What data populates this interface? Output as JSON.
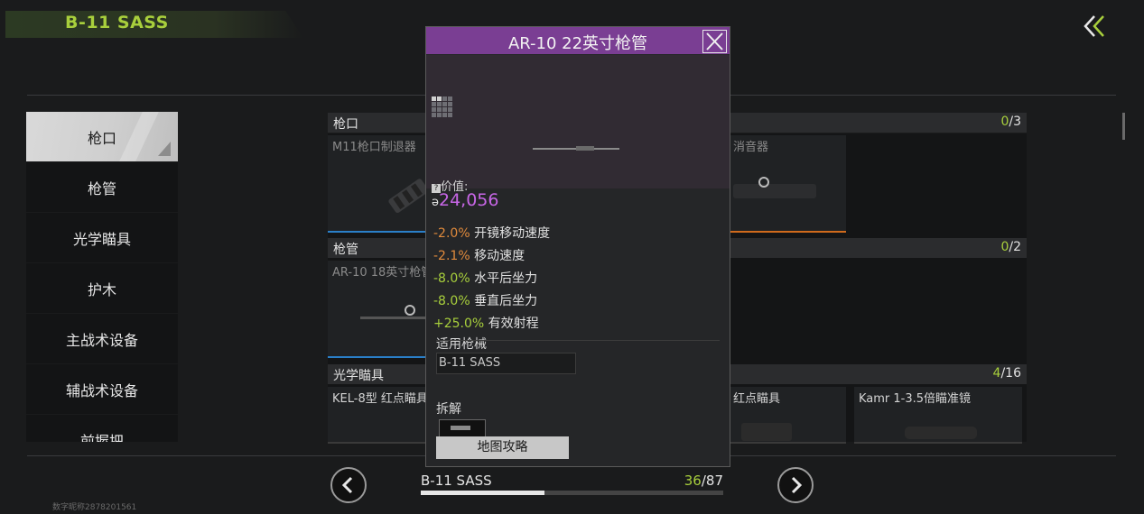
{
  "header": {
    "title": "B-11 SASS",
    "back_icon": "double-chevron-left-icon"
  },
  "sidebar": {
    "items": [
      {
        "label": "枪口",
        "active": true
      },
      {
        "label": "枪管"
      },
      {
        "label": "光学瞄具"
      },
      {
        "label": "护木"
      },
      {
        "label": "主战术设备"
      },
      {
        "label": "辅战术设备"
      },
      {
        "label": "前握把"
      }
    ]
  },
  "sections": [
    {
      "label": "枪口",
      "count_current": "0",
      "count_total": "/3",
      "cards": [
        "M11枪口制退器",
        "消音器"
      ]
    },
    {
      "label": "枪管",
      "count_current": "0",
      "count_total": "/2",
      "cards": [
        "AR-10 18英寸枪管"
      ]
    },
    {
      "label": "光学瞄具",
      "count_current": "4",
      "count_total": "/16",
      "cards": [
        "KEL-8型 红点瞄具",
        "红点瞄具",
        "Kamr 1-3.5倍瞄准镜"
      ]
    }
  ],
  "popup": {
    "title": "AR-10 22英寸枪管",
    "value_label": "价值:",
    "value": "24,056",
    "currency_glyph": "ə",
    "stats": [
      {
        "value": "-2.0%",
        "label": "开镜移动速度",
        "kind": "neg"
      },
      {
        "value": "-2.1%",
        "label": "移动速度",
        "kind": "neg"
      },
      {
        "value": "-8.0%",
        "label": "水平后坐力",
        "kind": "pos"
      },
      {
        "value": "-8.0%",
        "label": "垂直后坐力",
        "kind": "pos"
      },
      {
        "value": "+25.0%",
        "label": "有效射程",
        "kind": "pos"
      }
    ],
    "compat_label": "适用枪械",
    "compat_value": "B-11 SASS",
    "disassemble_label": "拆解",
    "map_button": "地图攻略"
  },
  "footer": {
    "weapon": "B-11 SASS",
    "progress_current": "36",
    "progress_total": "/87",
    "progress_fraction": 0.41,
    "user_label": "数字昵称2878201561"
  },
  "colors": {
    "accent": "#a8cf3c",
    "popup_title": "#7a3e93",
    "value": "#c766e6",
    "negative": "#e08a3c"
  }
}
